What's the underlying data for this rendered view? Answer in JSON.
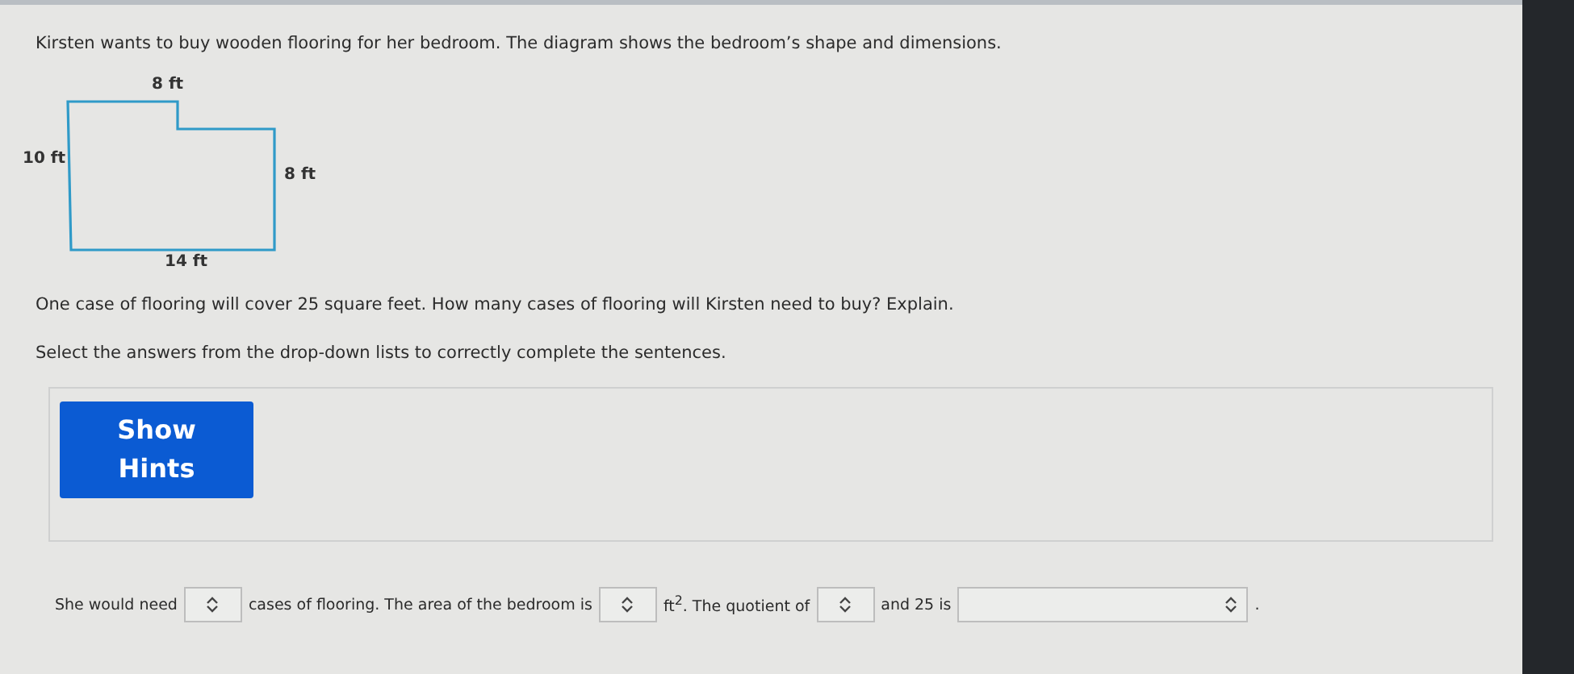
{
  "question": {
    "intro": "Kirsten wants to buy wooden flooring for her bedroom. The diagram shows the bedroom’s shape and dimensions.",
    "diagram": {
      "labels": [
        {
          "text": "8 ft"
        },
        {
          "text": "10 ft"
        },
        {
          "text": "8 ft"
        },
        {
          "text": "14 ft"
        }
      ]
    },
    "prompt": "One case of flooring will cover 25 square feet. How many cases of flooring will Kirsten need to buy? Explain.",
    "instruction": "Select the answers from the drop-down lists to correctly complete the sentences."
  },
  "hints_button": "Show Hints",
  "answer_sentence": [
    {
      "kind": "text",
      "text": "She would need"
    },
    {
      "kind": "dropdown"
    },
    {
      "kind": "text",
      "text": "cases of flooring. The area of the bedroom is"
    },
    {
      "kind": "dropdown"
    },
    {
      "kind": "text",
      "text": "ft$^{2}$. The quotient of"
    },
    {
      "kind": "dropdown"
    },
    {
      "kind": "text",
      "text": "and 25 is"
    },
    {
      "kind": "wide_dropdown"
    },
    {
      "kind": "text",
      "text": "."
    }
  ]
}
